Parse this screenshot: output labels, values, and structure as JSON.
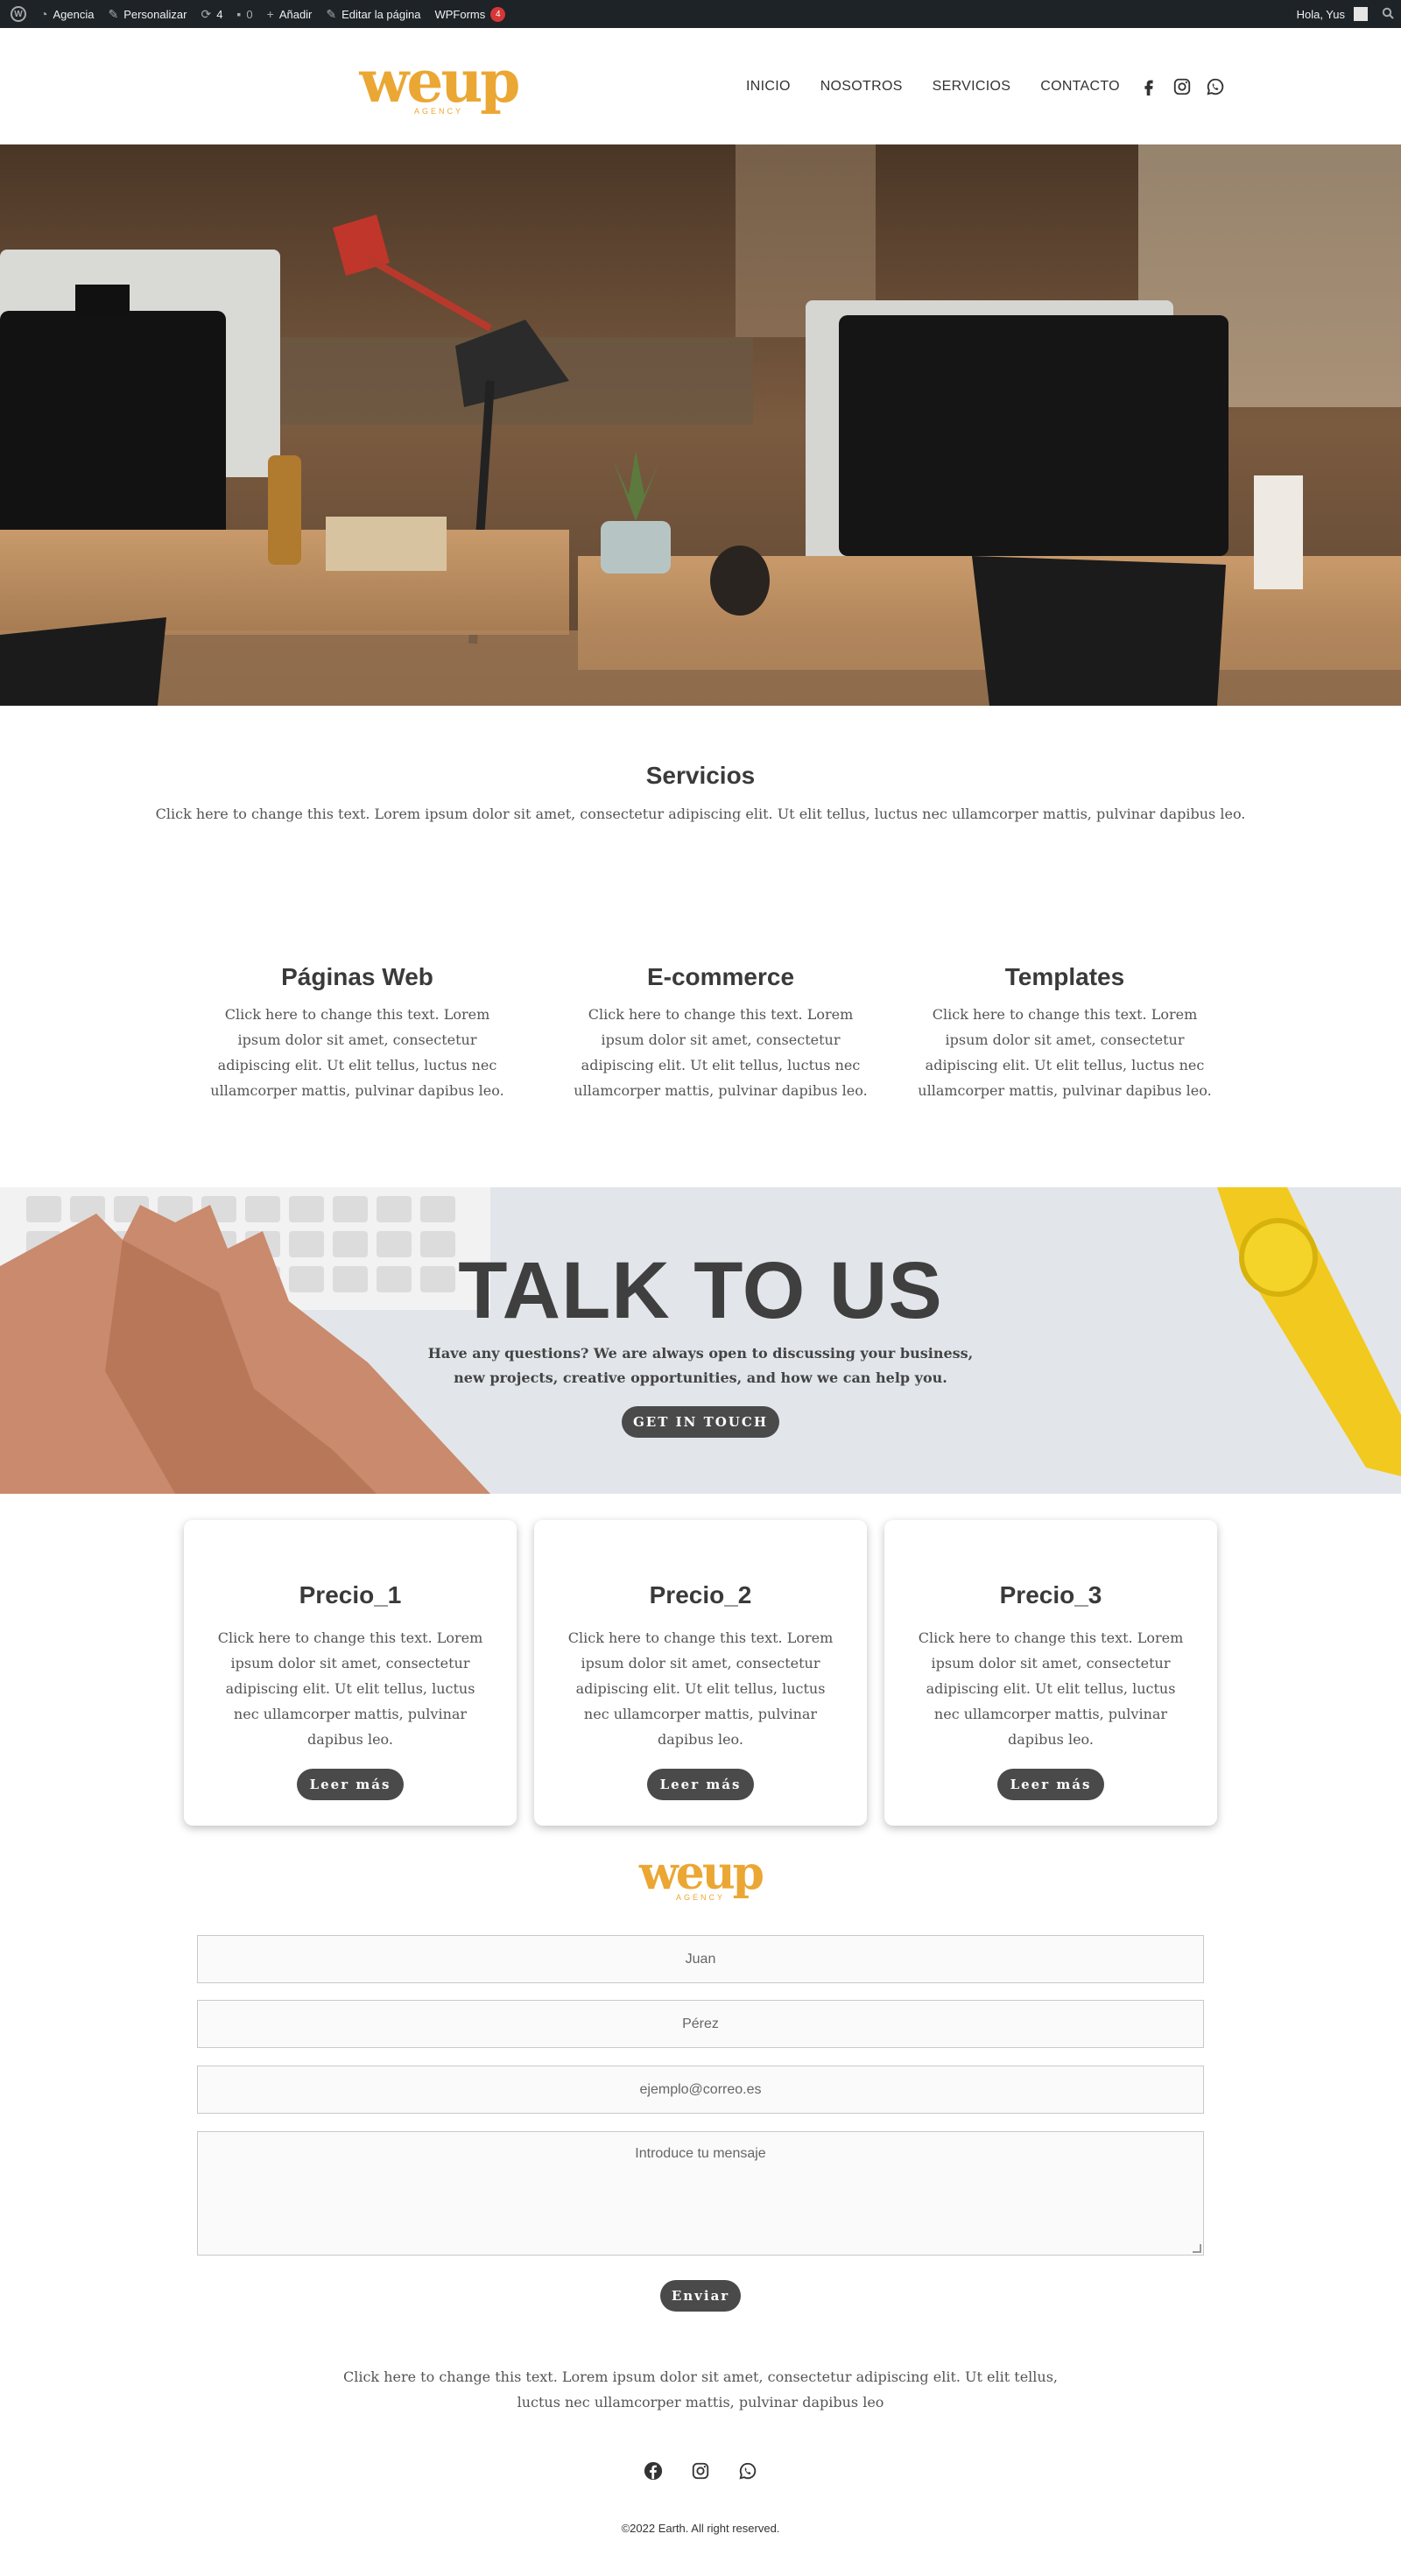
{
  "admin_bar": {
    "site": "Agencia",
    "customize": "Personalizar",
    "updates": "4",
    "comments": "0",
    "new": "Añadir",
    "edit": "Editar la página",
    "wpforms": "WPForms",
    "wpforms_count": "4",
    "greeting": "Hola, Yus"
  },
  "logo": {
    "text": "weup",
    "subtitle": "AGENCY"
  },
  "nav": [
    "INICIO",
    "NOSOTROS",
    "SERVICIOS",
    "CONTACTO"
  ],
  "social_icons": [
    "facebook-icon",
    "instagram-icon",
    "whatsapp-icon"
  ],
  "services": {
    "title": "Servicios",
    "text": "Click here to change this text. Lorem ipsum dolor sit amet, consectetur adipiscing elit. Ut elit tellus, luctus nec ullamcorper mattis, pulvinar dapibus leo.",
    "items": [
      {
        "title": "Páginas Web",
        "text": "Click here to change this text. Lorem ipsum dolor sit amet, consectetur adipiscing elit. Ut elit tellus, luctus nec ullamcorper mattis, pulvinar dapibus leo."
      },
      {
        "title": "E-commerce",
        "text": "Click here to change this text. Lorem ipsum dolor sit amet, consectetur adipiscing elit. Ut elit tellus, luctus nec ullamcorper mattis, pulvinar dapibus leo."
      },
      {
        "title": "Templates",
        "text": "Click here to change this text. Lorem ipsum dolor sit amet, consectetur adipiscing elit. Ut elit tellus, luctus nec ullamcorper mattis, pulvinar dapibus leo."
      }
    ]
  },
  "cta": {
    "title": "TALK TO US",
    "text": "Have any questions? We are always open to discussing your business, new projects, creative opportunities, and how we can help you.",
    "button": "GET IN TOUCH"
  },
  "prices": [
    {
      "title": "Precio_1",
      "text": "Click here to change this text. Lorem ipsum dolor sit amet, consectetur adipiscing elit. Ut elit tellus, luctus nec ullamcorper mattis, pulvinar dapibus leo.",
      "button": "Leer más"
    },
    {
      "title": "Precio_2",
      "text": "Click here to change this text. Lorem ipsum dolor sit amet, consectetur adipiscing elit. Ut elit tellus, luctus nec ullamcorper mattis, pulvinar dapibus leo.",
      "button": "Leer más"
    },
    {
      "title": "Precio_3",
      "text": "Click here to change this text. Lorem ipsum dolor sit amet, consectetur adipiscing elit. Ut elit tellus, luctus nec ullamcorper mattis, pulvinar dapibus leo.",
      "button": "Leer más"
    }
  ],
  "form": {
    "first_name": "Juan",
    "last_name": "Pérez",
    "email": "ejemplo@correo.es",
    "message": "Introduce tu mensaje",
    "submit": "Enviar"
  },
  "footer": {
    "text": "Click here to change this text. Lorem ipsum dolor sit amet, consectetur adipiscing elit. Ut elit tellus, luctus nec ullamcorper mattis, pulvinar dapibus leo",
    "copyright": "©2022 Earth. All right reserved."
  },
  "colors": {
    "brand": "#eba733",
    "admin_bar": "#1d2327",
    "button": "#4a4a4a"
  }
}
